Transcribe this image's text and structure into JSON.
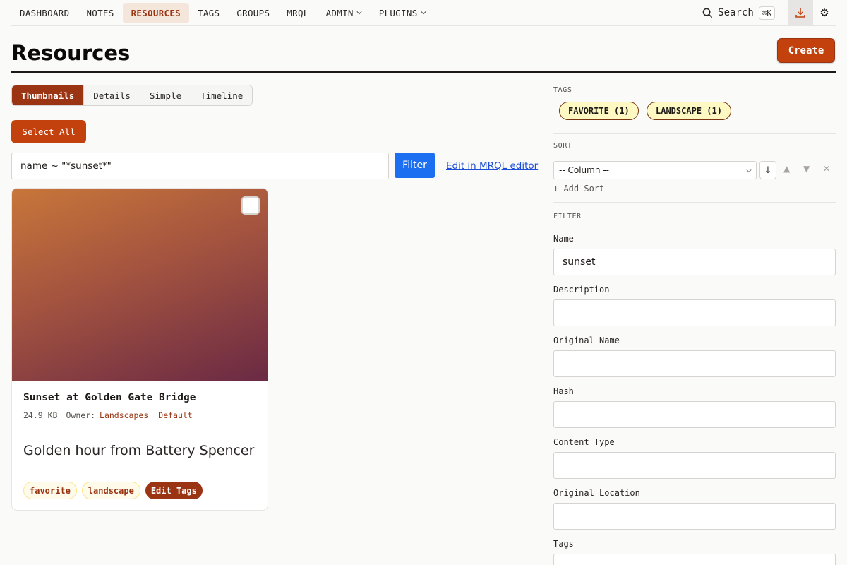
{
  "nav": {
    "items": [
      {
        "label": "DASHBOARD"
      },
      {
        "label": "NOTES"
      },
      {
        "label": "RESOURCES",
        "active": true
      },
      {
        "label": "TAGS"
      },
      {
        "label": "GROUPS"
      },
      {
        "label": "MRQL"
      },
      {
        "label": "ADMIN",
        "dropdown": true
      },
      {
        "label": "PLUGINS",
        "dropdown": true
      }
    ],
    "search_label": "Search",
    "search_shortcut": "⌘K",
    "download_icon": "download-icon",
    "settings_icon": "gear-icon"
  },
  "page": {
    "title": "Resources",
    "create_label": "Create"
  },
  "view_tabs": [
    {
      "label": "Thumbnails",
      "active": true
    },
    {
      "label": "Details"
    },
    {
      "label": "Simple"
    },
    {
      "label": "Timeline"
    }
  ],
  "select_all_label": "Select All",
  "query": {
    "value": "name ~ \"*sunset*\"",
    "filter_label": "Filter",
    "mrql_link": "Edit in MRQL editor"
  },
  "resource_card": {
    "title": "Sunset at Golden Gate Bridge",
    "size": "24.9 KB",
    "owner_label": "Owner:",
    "owner": "Landscapes",
    "category": "Default",
    "description": "Golden hour from Battery Spencer",
    "tags": [
      "favorite",
      "landscape"
    ],
    "edit_tags_label": "Edit Tags"
  },
  "sidebar": {
    "tags_heading": "TAGS",
    "tags": [
      "FAVORITE (1)",
      "LANDSCAPE (1)"
    ],
    "sort_heading": "SORT",
    "sort_column_placeholder": "-- Column --",
    "sort_direction_glyph": "↓",
    "add_sort_label": "+ Add Sort",
    "filter_heading": "FILTER",
    "filters": [
      {
        "label": "Name",
        "value": "sunset"
      },
      {
        "label": "Description",
        "value": ""
      },
      {
        "label": "Original Name",
        "value": ""
      },
      {
        "label": "Hash",
        "value": ""
      },
      {
        "label": "Content Type",
        "value": ""
      },
      {
        "label": "Original Location",
        "value": ""
      },
      {
        "label": "Tags",
        "value": ""
      }
    ]
  },
  "colors": {
    "accent": "#c2410c",
    "accent_dark": "#9a3412",
    "filter_blue": "#1d6ff2",
    "tag_yellow": "#fef9c3"
  }
}
